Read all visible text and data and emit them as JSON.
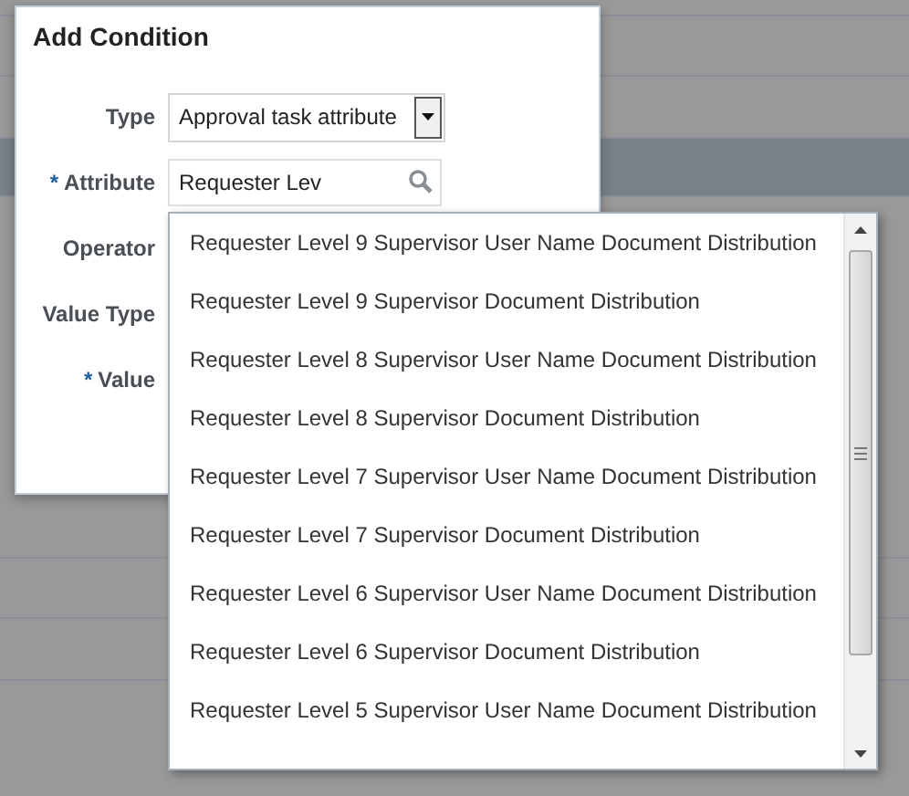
{
  "dialog": {
    "title": "Add Condition",
    "fields": [
      {
        "label": "Type",
        "kind": "select",
        "value": "Approval task attribute"
      },
      {
        "label": "Attribute",
        "marker": "*",
        "kind": "search",
        "value": "Requester Lev"
      },
      {
        "label": "Operator",
        "kind": "covered"
      },
      {
        "label": "Value Type",
        "kind": "covered"
      },
      {
        "label": "Value",
        "marker": "*",
        "kind": "covered"
      }
    ]
  },
  "suggestions": [
    "Requester Level 9 Supervisor User Name Document Distribution",
    "Requester Level 9 Supervisor Document Distribution",
    "Requester Level 8 Supervisor User Name Document Distribution",
    "Requester Level 8 Supervisor Document Distribution",
    "Requester Level 7 Supervisor User Name Document Distribution",
    "Requester Level 7 Supervisor Document Distribution",
    "Requester Level 6 Supervisor User Name Document Distribution",
    "Requester Level 6 Supervisor Document Distribution",
    "Requester Level 5 Supervisor User Name Document Distribution"
  ]
}
